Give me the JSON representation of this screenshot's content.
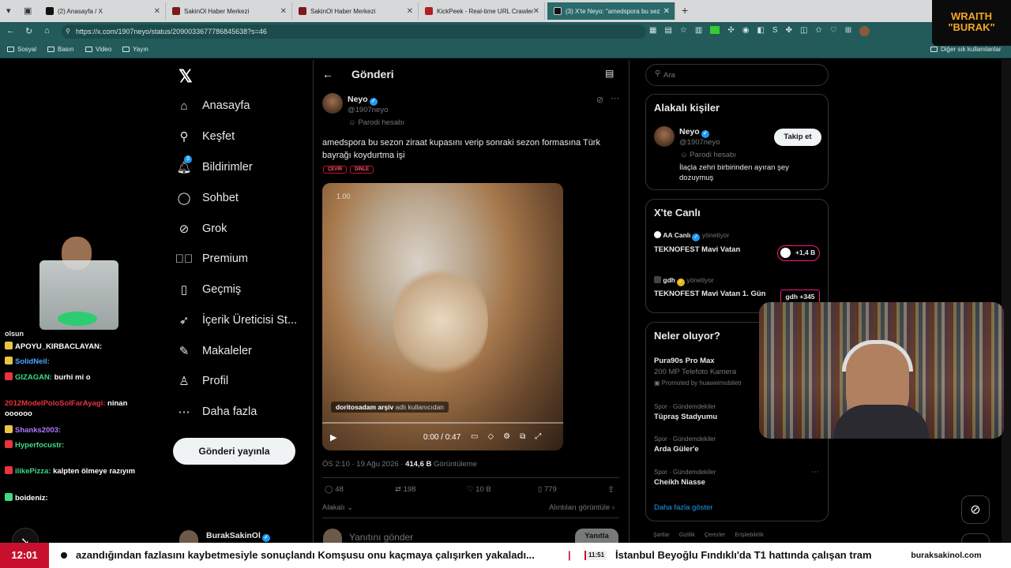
{
  "browser": {
    "tabs": [
      {
        "label": "(2) Anasayfa / X"
      },
      {
        "label": "SakinOl Haber Merkezi"
      },
      {
        "label": "SakinOl Haber Merkezi"
      },
      {
        "label": "KickPeek - Real-time URL Crawler"
      },
      {
        "label": "(3) X'te Neyo: \"amedspora bu sez"
      }
    ],
    "url": "https://x.com/1907neyo/status/2090033677786845638?s=46",
    "bookmarks": [
      "Sosyal",
      "Basın",
      "Video",
      "Yayın"
    ],
    "bookmarks_right": "Diğer sık kullanılanlar"
  },
  "overlay": {
    "logo_line1": "WRAITH",
    "logo_line2": "\"BURAK\""
  },
  "nav": {
    "items": [
      {
        "label": "Anasayfa",
        "icon": "home-icon"
      },
      {
        "label": "Keşfet",
        "icon": "search-icon"
      },
      {
        "label": "Bildirimler",
        "icon": "bell-icon",
        "badge": "3"
      },
      {
        "label": "Sohbet",
        "icon": "chat-icon"
      },
      {
        "label": "Grok",
        "icon": "grok-icon"
      },
      {
        "label": "Premium",
        "icon": "premium-icon"
      },
      {
        "label": "Geçmiş",
        "icon": "bookmark-icon"
      },
      {
        "label": "İçerik Üreticisi St...",
        "icon": "rocket-icon"
      },
      {
        "label": "Makaleler",
        "icon": "article-icon"
      },
      {
        "label": "Profil",
        "icon": "profile-icon"
      },
      {
        "label": "Daha fazla",
        "icon": "more-icon"
      }
    ],
    "post_button": "Gönderi yayınla",
    "account_name": "BurakSakinOl"
  },
  "post": {
    "header_title": "Gönderi",
    "author_name": "Neyo",
    "author_handle": "@1907neyo",
    "parody_label": "Parodi hesabı",
    "text": "amedspora bu sezon ziraat kupasını verip sonraki sezon formasına Türk bayrağı koydurtma işi",
    "translate_label": "ÇEVİR",
    "listen_label": "DİNLE",
    "video_speed": "1.00",
    "video_credit_user": "doritosadam arşiv",
    "video_credit_suffix": "adlı kullanıcıdan",
    "video_time": "0:00 / 0:47",
    "meta_time": "ÖS 2:10 · 19 Ağu 2026 ·",
    "views": "414,6 B",
    "views_label": "Görüntüleme",
    "stats": {
      "replies": "48",
      "reposts": "198",
      "likes": "10 B",
      "bookmarks": "779"
    },
    "relevant_label": "Alakalı",
    "quotes_label": "Alıntıları görüntüle",
    "reply_placeholder": "Yanıtını gönder",
    "reply_button": "Yanıtla"
  },
  "right": {
    "search_placeholder": "Ara",
    "relevant_people_title": "Alakalı kişiler",
    "person": {
      "name": "Neyo",
      "handle": "@1907neyo",
      "parody": "Parodi hesabı",
      "bio": "İlaçla zehri birbirinden ayıran şey dozuymuş",
      "follow": "Takip et"
    },
    "live_title": "X'te Canlı",
    "live": [
      {
        "host": "AA Canlı",
        "role": "yönetiyor",
        "title": "TEKNOFEST Mavi Vatan",
        "count": "+1,4 B"
      },
      {
        "host": "gdh",
        "role": "yönetiyor",
        "title": "TEKNOFEST Mavi Vatan 1. Gün",
        "count": "+345"
      }
    ],
    "trends_title": "Neler oluyor?",
    "promo": {
      "title": "Pura90s Pro Max",
      "sub": "200 MP Telefoto Kamera",
      "by": "Promoted by huaweimobiletr"
    },
    "trends": [
      {
        "cat": "Spor · Gündemdekiler",
        "name": "Tüpraş Stadyumu"
      },
      {
        "cat": "Spor · Gündemdekiler",
        "name": "Arda Güler'e"
      },
      {
        "cat": "Spor · Gündemdekiler",
        "name": "Cheikh Niasse"
      }
    ],
    "show_more": "Daha fazla göster",
    "footer": [
      "Şartlar",
      "Gizlilik",
      "Çerezler",
      "Erişilebilirlik"
    ]
  },
  "chat": [
    {
      "user": "APOYU_KIRBACLAYAN:",
      "msg": "",
      "color": "#ffffff",
      "badge": "#e8c44a"
    },
    {
      "user": "SolidNeil:",
      "msg": "",
      "color": "#4aa8ff",
      "badge": "#e8c44a"
    },
    {
      "user": "GIZAGAN:",
      "msg": "burhi mi o",
      "color": "#3ddc84",
      "badge": "#e8343d"
    },
    {
      "user": "2012ModelPoloSolFarAyagi:",
      "msg": "ninan oooooo",
      "color": "#e8343d",
      "badge": ""
    },
    {
      "user": "Shanks2003:",
      "msg": "",
      "color": "#b07cff",
      "badge": "#e8c44a"
    },
    {
      "user": "Hyperfocustr:",
      "msg": "",
      "color": "#3ddc84",
      "badge": "#e8343d"
    },
    {
      "user": "ilikePizza:",
      "msg": "kalpten ölmeye razıyım",
      "color": "#3ddc84",
      "badge": "#e8343d"
    },
    {
      "user": "boideniz:",
      "msg": "",
      "color": "#ffffff",
      "badge": "#3ddc84"
    }
  ],
  "ticker": {
    "time": "12:01",
    "headline1": "azandığından fazlasını kaybetmesiyle sonuçlandı Komşusu onu kaçmaya çalışırken yakaladı...",
    "time2": "11:51",
    "headline2": "İstanbul Beyoğlu Fındıklı'da T1 hattında çalışan tram",
    "site": "buraksakinol.com"
  }
}
